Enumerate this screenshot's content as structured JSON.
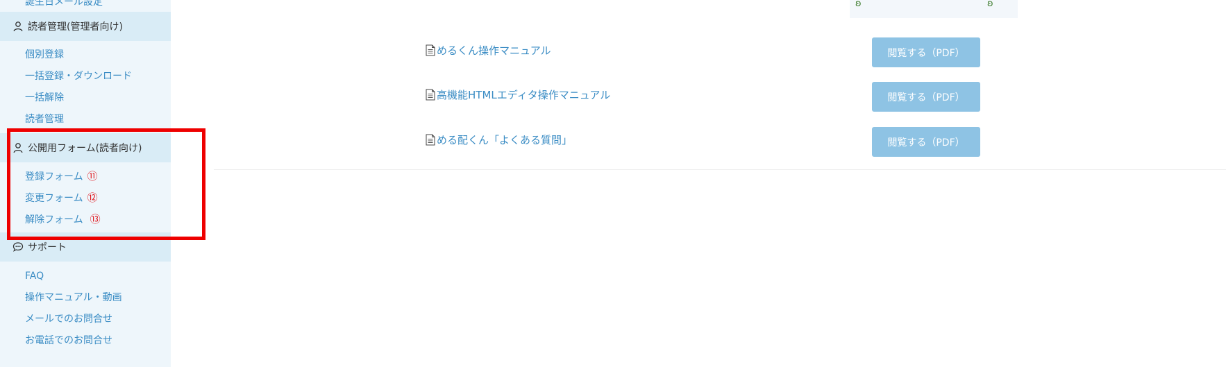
{
  "sidebar": {
    "cut_item": "誕生日メール設定",
    "sections": [
      {
        "title": "読者管理(管理者向け)",
        "icon": "user-icon",
        "items": [
          "個別登録",
          "一括登録・ダウンロード",
          "一括解除",
          "読者管理"
        ]
      },
      {
        "title": "公開用フォーム(読者向け)",
        "icon": "user-icon",
        "items": [
          {
            "label": "登録フォーム",
            "mark": "⑪"
          },
          {
            "label": "変更フォーム",
            "mark": "⑫"
          },
          {
            "label": "解除フォーム",
            "mark": "⑬"
          }
        ]
      },
      {
        "title": "サポート",
        "icon": "chat-bubble-icon",
        "items": [
          "FAQ",
          "操作マニュアル・動画",
          "メールでのお問合せ",
          "お電話でのお問合せ"
        ]
      }
    ]
  },
  "documents": [
    {
      "title": "めるくん操作マニュアル",
      "button": "閲覧する（PDF）"
    },
    {
      "title": "高機能HTMLエディタ操作マニュアル",
      "button": "閲覧する（PDF）"
    },
    {
      "title": " める配くん「よくある質問」",
      "button": "閲覧する（PDF）"
    }
  ],
  "colors": {
    "sidebar_bg": "#eef6fb",
    "section_bg": "#d9ecf6",
    "link": "#3a8cc4",
    "button_bg": "#8ec3e4",
    "highlight": "#ee0000",
    "annotation": "#e0141b"
  }
}
